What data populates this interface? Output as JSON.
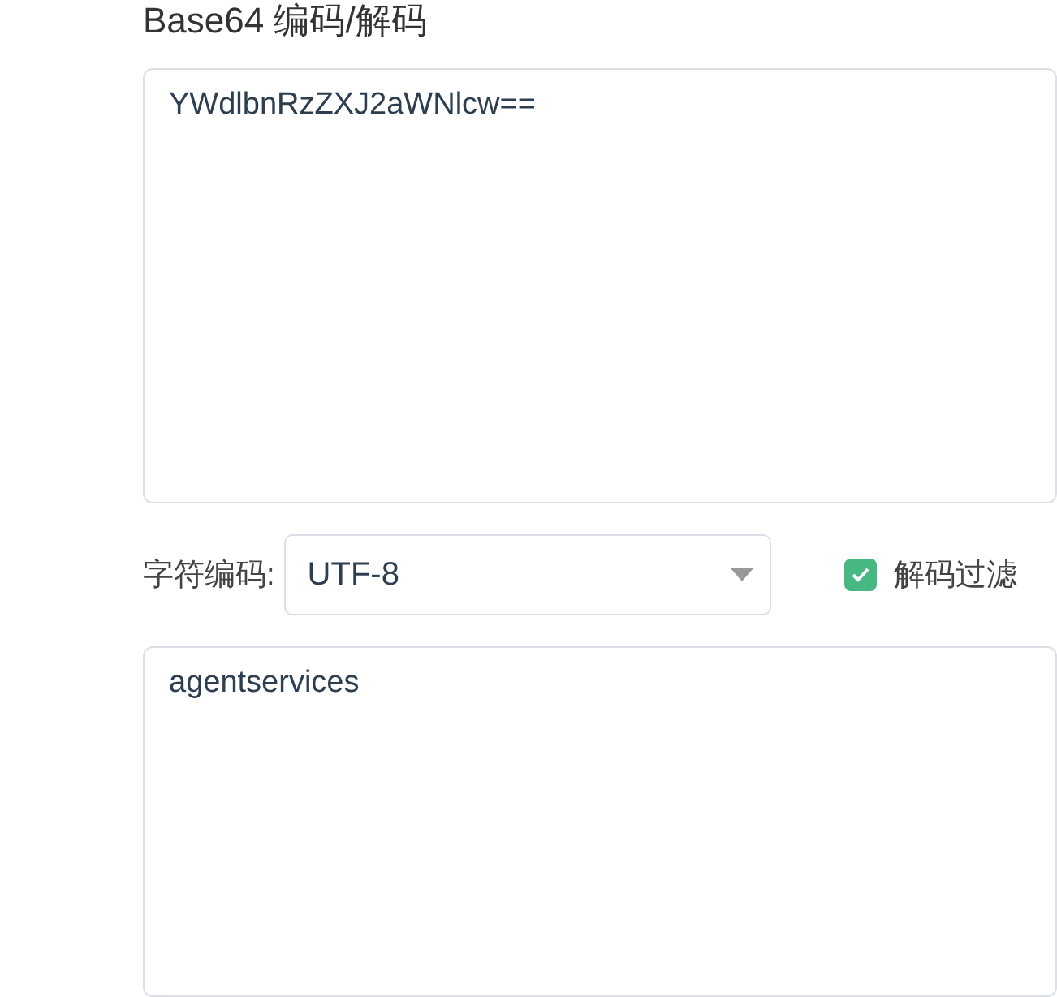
{
  "title": "Base64 编码/解码",
  "input": {
    "value": "YWdlbnRzZXJ2aWNlcw=="
  },
  "charset": {
    "label": "字符编码:",
    "value": "UTF-8"
  },
  "decode_filter": {
    "label": "解码过滤",
    "checked": true
  },
  "output": {
    "value": "agentservices"
  }
}
